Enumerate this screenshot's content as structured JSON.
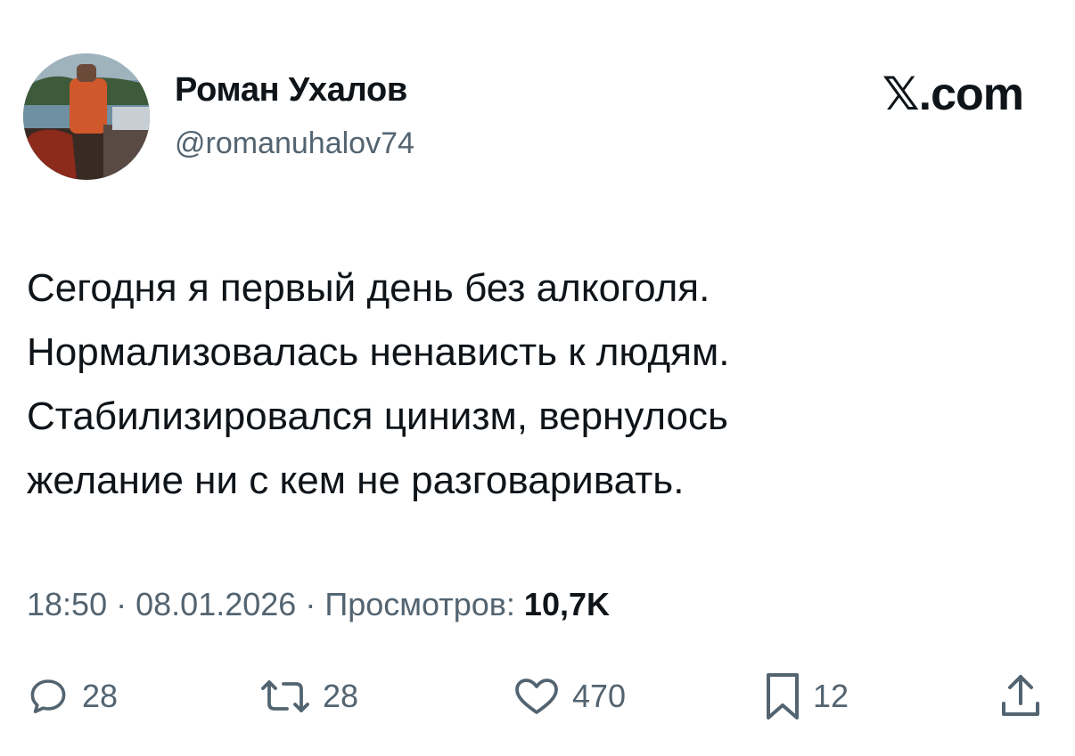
{
  "author": {
    "display_name": "Роман Ухалов",
    "handle": "@romanuhalov74",
    "avatar_icon": "profile-photo"
  },
  "brand": {
    "logo_text": "𝕏.com"
  },
  "tweet": {
    "lines": [
      "Сегодня я первый день без алкоголя.",
      "Нормализовалась ненависть к людям.",
      "Стабилизировался цинизм, вернулось",
      "желание ни с кем не разговаривать."
    ],
    "time": "18:50",
    "date": "08.01.2026",
    "views_label": "Просмотров:",
    "views_count": "10,7K",
    "separator": "·"
  },
  "actions": {
    "reply": {
      "icon": "reply-icon",
      "count": "28"
    },
    "repost": {
      "icon": "repost-icon",
      "count": "28"
    },
    "like": {
      "icon": "heart-icon",
      "count": "470"
    },
    "bookmark": {
      "icon": "bookmark-icon",
      "count": "12"
    },
    "share": {
      "icon": "share-icon"
    }
  },
  "colors": {
    "text_primary": "#0f1419",
    "text_secondary": "#536471",
    "background": "#ffffff"
  }
}
